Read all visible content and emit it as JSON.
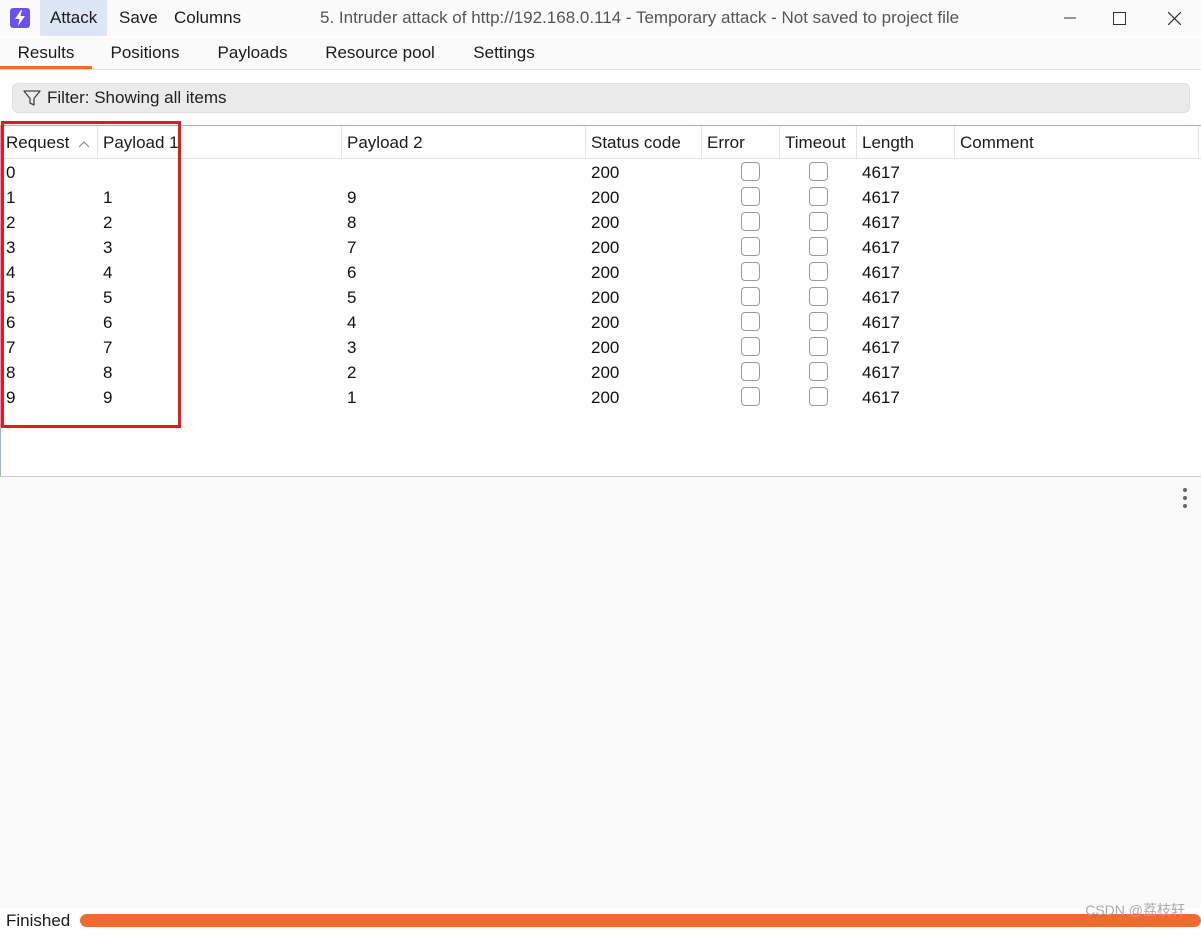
{
  "menu": {
    "attack": "Attack",
    "save": "Save",
    "columns": "Columns"
  },
  "window": {
    "title": "5. Intruder attack of http://192.168.0.114 - Temporary attack - Not saved to project file"
  },
  "tabs": [
    {
      "label": "Results"
    },
    {
      "label": "Positions"
    },
    {
      "label": "Payloads"
    },
    {
      "label": "Resource pool"
    },
    {
      "label": "Settings"
    }
  ],
  "filter": {
    "label": "Filter: Showing all items"
  },
  "table": {
    "columns": [
      "Request",
      "Payload 1",
      "Payload 2",
      "Status code",
      "Error",
      "Timeout",
      "Length",
      "Comment"
    ],
    "sort_column": "Request",
    "rows": [
      {
        "request": "0",
        "payload1": "",
        "payload2": "",
        "status": "200",
        "error": false,
        "timeout": false,
        "length": "4617",
        "comment": ""
      },
      {
        "request": "1",
        "payload1": "1",
        "payload2": "9",
        "status": "200",
        "error": false,
        "timeout": false,
        "length": "4617",
        "comment": ""
      },
      {
        "request": "2",
        "payload1": "2",
        "payload2": "8",
        "status": "200",
        "error": false,
        "timeout": false,
        "length": "4617",
        "comment": ""
      },
      {
        "request": "3",
        "payload1": "3",
        "payload2": "7",
        "status": "200",
        "error": false,
        "timeout": false,
        "length": "4617",
        "comment": ""
      },
      {
        "request": "4",
        "payload1": "4",
        "payload2": "6",
        "status": "200",
        "error": false,
        "timeout": false,
        "length": "4617",
        "comment": ""
      },
      {
        "request": "5",
        "payload1": "5",
        "payload2": "5",
        "status": "200",
        "error": false,
        "timeout": false,
        "length": "4617",
        "comment": ""
      },
      {
        "request": "6",
        "payload1": "6",
        "payload2": "4",
        "status": "200",
        "error": false,
        "timeout": false,
        "length": "4617",
        "comment": ""
      },
      {
        "request": "7",
        "payload1": "7",
        "payload2": "3",
        "status": "200",
        "error": false,
        "timeout": false,
        "length": "4617",
        "comment": ""
      },
      {
        "request": "8",
        "payload1": "8",
        "payload2": "2",
        "status": "200",
        "error": false,
        "timeout": false,
        "length": "4617",
        "comment": ""
      },
      {
        "request": "9",
        "payload1": "9",
        "payload2": "1",
        "status": "200",
        "error": false,
        "timeout": false,
        "length": "4617",
        "comment": ""
      }
    ]
  },
  "status": {
    "label": "Finished",
    "progress": 1.0
  },
  "watermark": "CSDN @荔枝轩",
  "colors": {
    "accent": "#f26a2e",
    "highlight": "#e31b1b",
    "app_icon": "#6c4ff1"
  },
  "icons": {
    "app": "lightning-icon",
    "filter": "funnel-icon",
    "sort": "chevron-up-icon",
    "more": "kebab-icon"
  }
}
